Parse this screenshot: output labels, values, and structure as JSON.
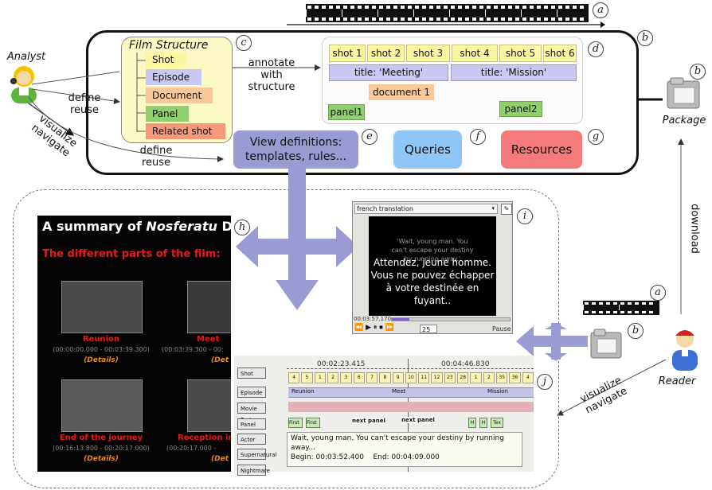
{
  "roles": {
    "analyst": "Analyst",
    "package": "Package",
    "reader": "Reader",
    "download": "download"
  },
  "labels": {
    "define_reuse_1": [
      "define",
      "reuse"
    ],
    "visualize_navigate_1": [
      "visualize",
      "navigate"
    ],
    "define_reuse_2": [
      "define",
      "reuse"
    ],
    "annotate": [
      "annotate",
      "with",
      "structure"
    ],
    "visualize_navigate_2": [
      "visualize",
      "navigate"
    ]
  },
  "film_structure": {
    "title": "Film Structure",
    "items": [
      {
        "label": "Shot",
        "color": "#fbf7a0"
      },
      {
        "label": "Episode",
        "color": "#c8c8f2"
      },
      {
        "label": "Document",
        "color": "#f9c89a"
      },
      {
        "label": "Panel",
        "color": "#8fcf6c"
      },
      {
        "label": "Related shot",
        "color": "#f6997a"
      }
    ]
  },
  "annotation": {
    "shots": [
      "shot 1",
      "shot 2",
      "shot 3",
      "shot 4",
      "shot 5",
      "shot 6"
    ],
    "episodes": [
      "title: 'Meeting'",
      "title: 'Mission'"
    ],
    "document": "document 1",
    "panels": [
      "panel1",
      "panel2"
    ]
  },
  "boxes": {
    "view_definitions": [
      "View definitions:",
      "templates, rules..."
    ],
    "queries": "Queries",
    "resources": "Resources"
  },
  "markers": [
    "a",
    "b",
    "c",
    "d",
    "e",
    "f",
    "g",
    "h",
    "i",
    "j"
  ],
  "summary": {
    "title_prefix": "A summary of ",
    "title_italic": "Nosferatu",
    "title_suffix": " D",
    "subtitle": "The different parts of the film:",
    "parts": [
      {
        "name": "Reunion",
        "time": "(00:00:00.000 - 00:03:39.300)",
        "details": "(Details)"
      },
      {
        "name": "Meet",
        "time": "(00:03:39.300 - 00:",
        "details": "(Det"
      },
      {
        "name": "End of the journey",
        "time": "(00:16:13.800 - 00:20:17.000)",
        "details": "(Details)"
      },
      {
        "name": "Reception in",
        "time": "(00:20:17.000 -",
        "details": "(Det"
      }
    ]
  },
  "video_player": {
    "dropdown": "french translation",
    "subtitle_en": [
      "'Wait, young man. You",
      "can't escape your destiny",
      "by running away.'"
    ],
    "subtitle_fr": [
      "Attendez, jeune homme.",
      "Vous ne pouvez échapper",
      "à votre destinée en",
      "fuyant.."
    ],
    "time": "00:03:57.170",
    "rate": "25",
    "state": "Pause"
  },
  "timeline": {
    "times": [
      "00:02:23.415",
      "00:04:46.830"
    ],
    "rows": [
      "Shot",
      "Episode",
      "Movie Part",
      "Panel",
      "Actor",
      "Supernatural",
      "Nightmare"
    ],
    "shot_numbers": [
      "4",
      "5",
      "1",
      "2",
      "3",
      "6",
      "7",
      "8",
      "9",
      "10",
      "11",
      "12",
      "23",
      "28",
      "1",
      "2",
      "35",
      "36",
      "4"
    ],
    "episode_labels": [
      "Reunion",
      "Meet",
      "Mission"
    ],
    "panel_cells": [
      "First",
      "First",
      "next panel",
      "next panel",
      "H",
      "H",
      "Tex"
    ],
    "caption": "Wait, young man. You can't escape your destiny by running away...",
    "begin_label": "Begin: 00:03:52.400",
    "end_label": "End: 00:04:09.000"
  }
}
